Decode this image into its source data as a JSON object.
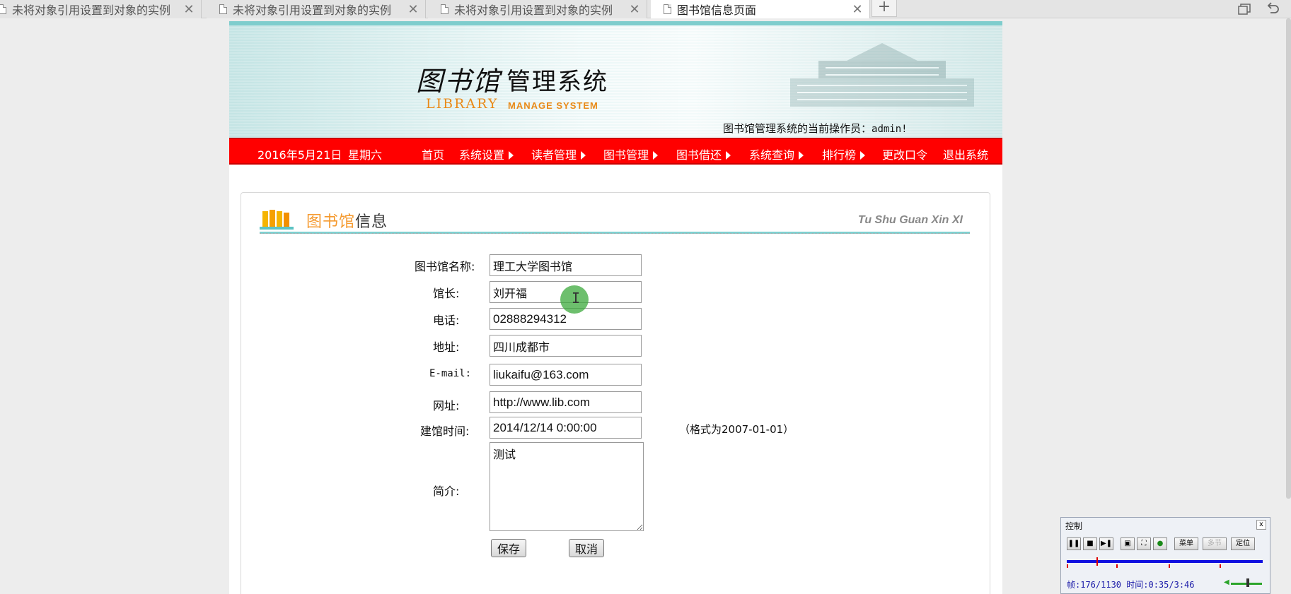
{
  "browser": {
    "tabs": [
      {
        "title": "未将对象引用设置到对象的实例"
      },
      {
        "title": "未将对象引用设置到对象的实例"
      },
      {
        "title": "未将对象引用设置到对象的实例"
      },
      {
        "title": "图书馆信息页面"
      }
    ],
    "new_tab": "+",
    "close": "✕"
  },
  "header": {
    "logo_cn_script": "图书馆",
    "logo_cn": "管理系统",
    "logo_en1": "LIBRARY",
    "logo_en2": "MANAGE SYSTEM",
    "operator_label": "图书馆管理系统的当前操作员：",
    "operator_user": "admin!"
  },
  "nav": {
    "date": "2016年5月21日",
    "weekday": "星期六",
    "items": [
      {
        "label": "首页",
        "has_submenu": false
      },
      {
        "label": "系统设置",
        "has_submenu": true
      },
      {
        "label": "读者管理",
        "has_submenu": true
      },
      {
        "label": "图书管理",
        "has_submenu": true
      },
      {
        "label": "图书借还",
        "has_submenu": true
      },
      {
        "label": "系统查询",
        "has_submenu": true
      },
      {
        "label": "排行榜",
        "has_submenu": true
      },
      {
        "label": "更改口令",
        "has_submenu": false
      },
      {
        "label": "退出系统",
        "has_submenu": false
      }
    ]
  },
  "panel": {
    "title_a": "图书馆",
    "title_b": "信息",
    "title_en": "Tu Shu Guan Xin XI"
  },
  "form": {
    "name_label": "图书馆名称:",
    "name_value": "理工大学图书馆",
    "curator_label": "馆长:",
    "curator_value": "刘开福",
    "phone_label": "电话:",
    "phone_value": "02888294312",
    "address_label": "地址:",
    "address_value": "四川成都市",
    "email_label": "E-mail:",
    "email_value": "liukaifu@163.com",
    "url_label": "网址:",
    "url_value": "http://www.lib.com",
    "founded_label": "建馆时间:",
    "founded_value": "2014/12/14 0:00:00",
    "founded_hint": "（格式为2007-01-01）",
    "intro_label": "简介:",
    "intro_value": "测试",
    "save": "保存",
    "cancel": "取消"
  },
  "control": {
    "title": "控制",
    "close": "x",
    "menu": "菜单",
    "multi": "多节",
    "locate": "定位",
    "status": "帧:176/1130 时间:0:35/3:46"
  }
}
